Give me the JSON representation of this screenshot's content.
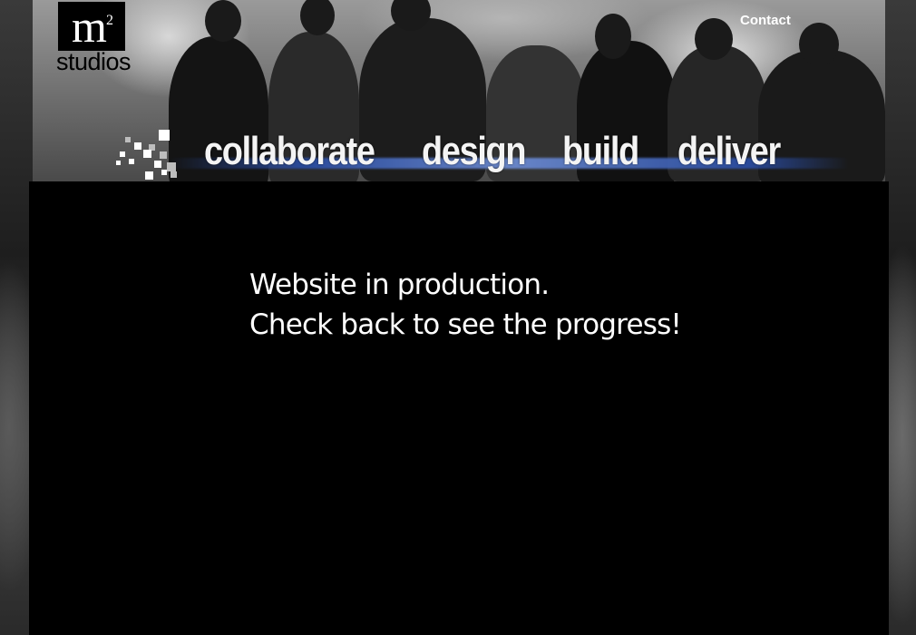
{
  "brand": {
    "logo_mark": "m",
    "logo_superscript": "2",
    "logo_wordmark": "studios"
  },
  "header": {
    "contact_label": "Contact"
  },
  "nav": {
    "items": [
      {
        "label": "collaborate"
      },
      {
        "label": "design"
      },
      {
        "label": "build"
      },
      {
        "label": "deliver"
      }
    ]
  },
  "main": {
    "line1": "Website in production.",
    "line2": "Check back to see the progress!"
  },
  "colors": {
    "background": "#000000",
    "text": "#ffffff",
    "accent_stripe": "#2b4fa8"
  },
  "icons": {
    "pixel_mosaic": "pixel-mosaic-icon"
  }
}
